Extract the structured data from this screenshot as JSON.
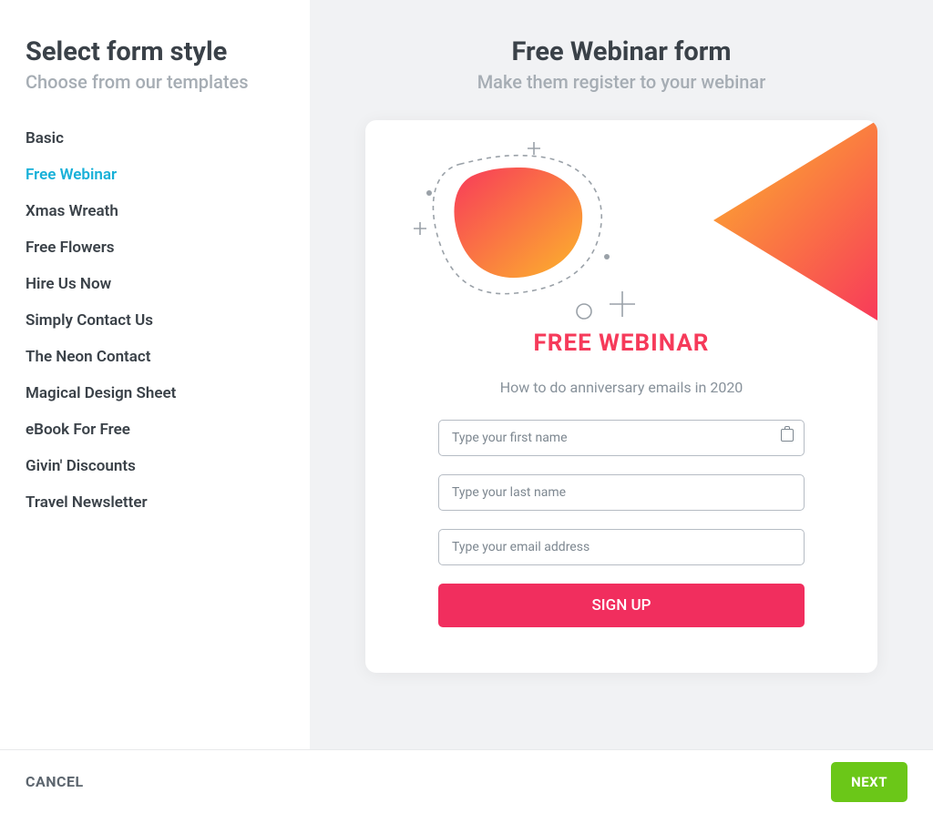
{
  "sidebar": {
    "title": "Select form style",
    "subtitle": "Choose from our templates",
    "items": [
      {
        "label": "Basic",
        "active": false
      },
      {
        "label": "Free Webinar",
        "active": true
      },
      {
        "label": "Xmas Wreath",
        "active": false
      },
      {
        "label": "Free Flowers",
        "active": false
      },
      {
        "label": "Hire Us Now",
        "active": false
      },
      {
        "label": "Simply Contact Us",
        "active": false
      },
      {
        "label": "The Neon Contact",
        "active": false
      },
      {
        "label": "Magical Design Sheet",
        "active": false
      },
      {
        "label": "eBook For Free",
        "active": false
      },
      {
        "label": "Givin' Discounts",
        "active": false
      },
      {
        "label": "Travel Newsletter",
        "active": false
      }
    ]
  },
  "preview": {
    "title": "Free Webinar form",
    "subtitle": "Make them register to your webinar"
  },
  "form": {
    "heading": "FREE WEBINAR",
    "description": "How to do anniversary emails in 2020",
    "firstname_placeholder": "Type your first name",
    "lastname_placeholder": "Type your last name",
    "email_placeholder": "Type your email address",
    "submit_label": "SIGN UP"
  },
  "footer": {
    "cancel_label": "CANCEL",
    "next_label": "NEXT"
  },
  "colors": {
    "accent": "#17b0d8",
    "primary_action": "#6bc718",
    "form_accent": "#f12e5e",
    "gradient_start": "#fcb52b",
    "gradient_end": "#f83a5a"
  }
}
